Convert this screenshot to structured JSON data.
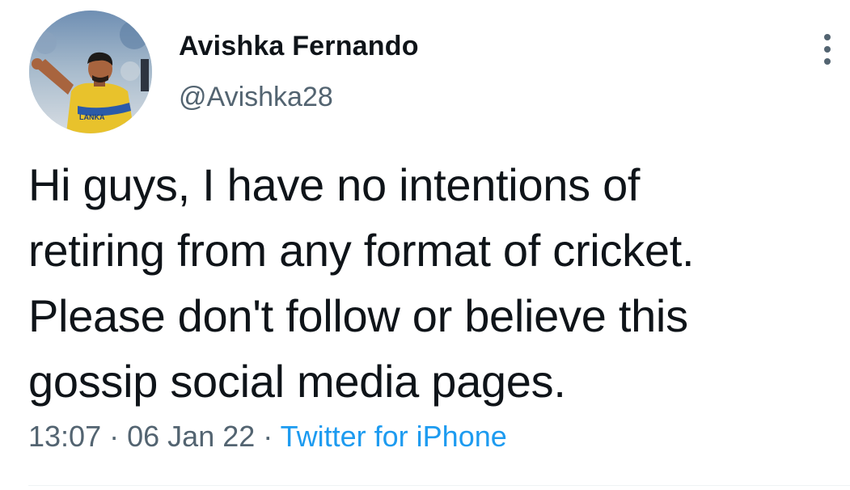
{
  "author": {
    "display_name": "Avishka Fernando",
    "handle": "@Avishka28",
    "avatar_jersey_text": "LANKA"
  },
  "tweet": {
    "text": "Hi guys, I have no intentions of\nretiring from any format of cricket.\nPlease don't follow or believe this\ngossip social media pages."
  },
  "meta": {
    "time": "13:07",
    "separator": "·",
    "date": "06 Jan 22",
    "source": "Twitter for iPhone"
  },
  "icons": {
    "more": "more-vertical-icon"
  },
  "colors": {
    "text": "#0f1419",
    "secondary": "#536471",
    "link": "#1d9bf0",
    "jersey": "#e8c22c"
  }
}
